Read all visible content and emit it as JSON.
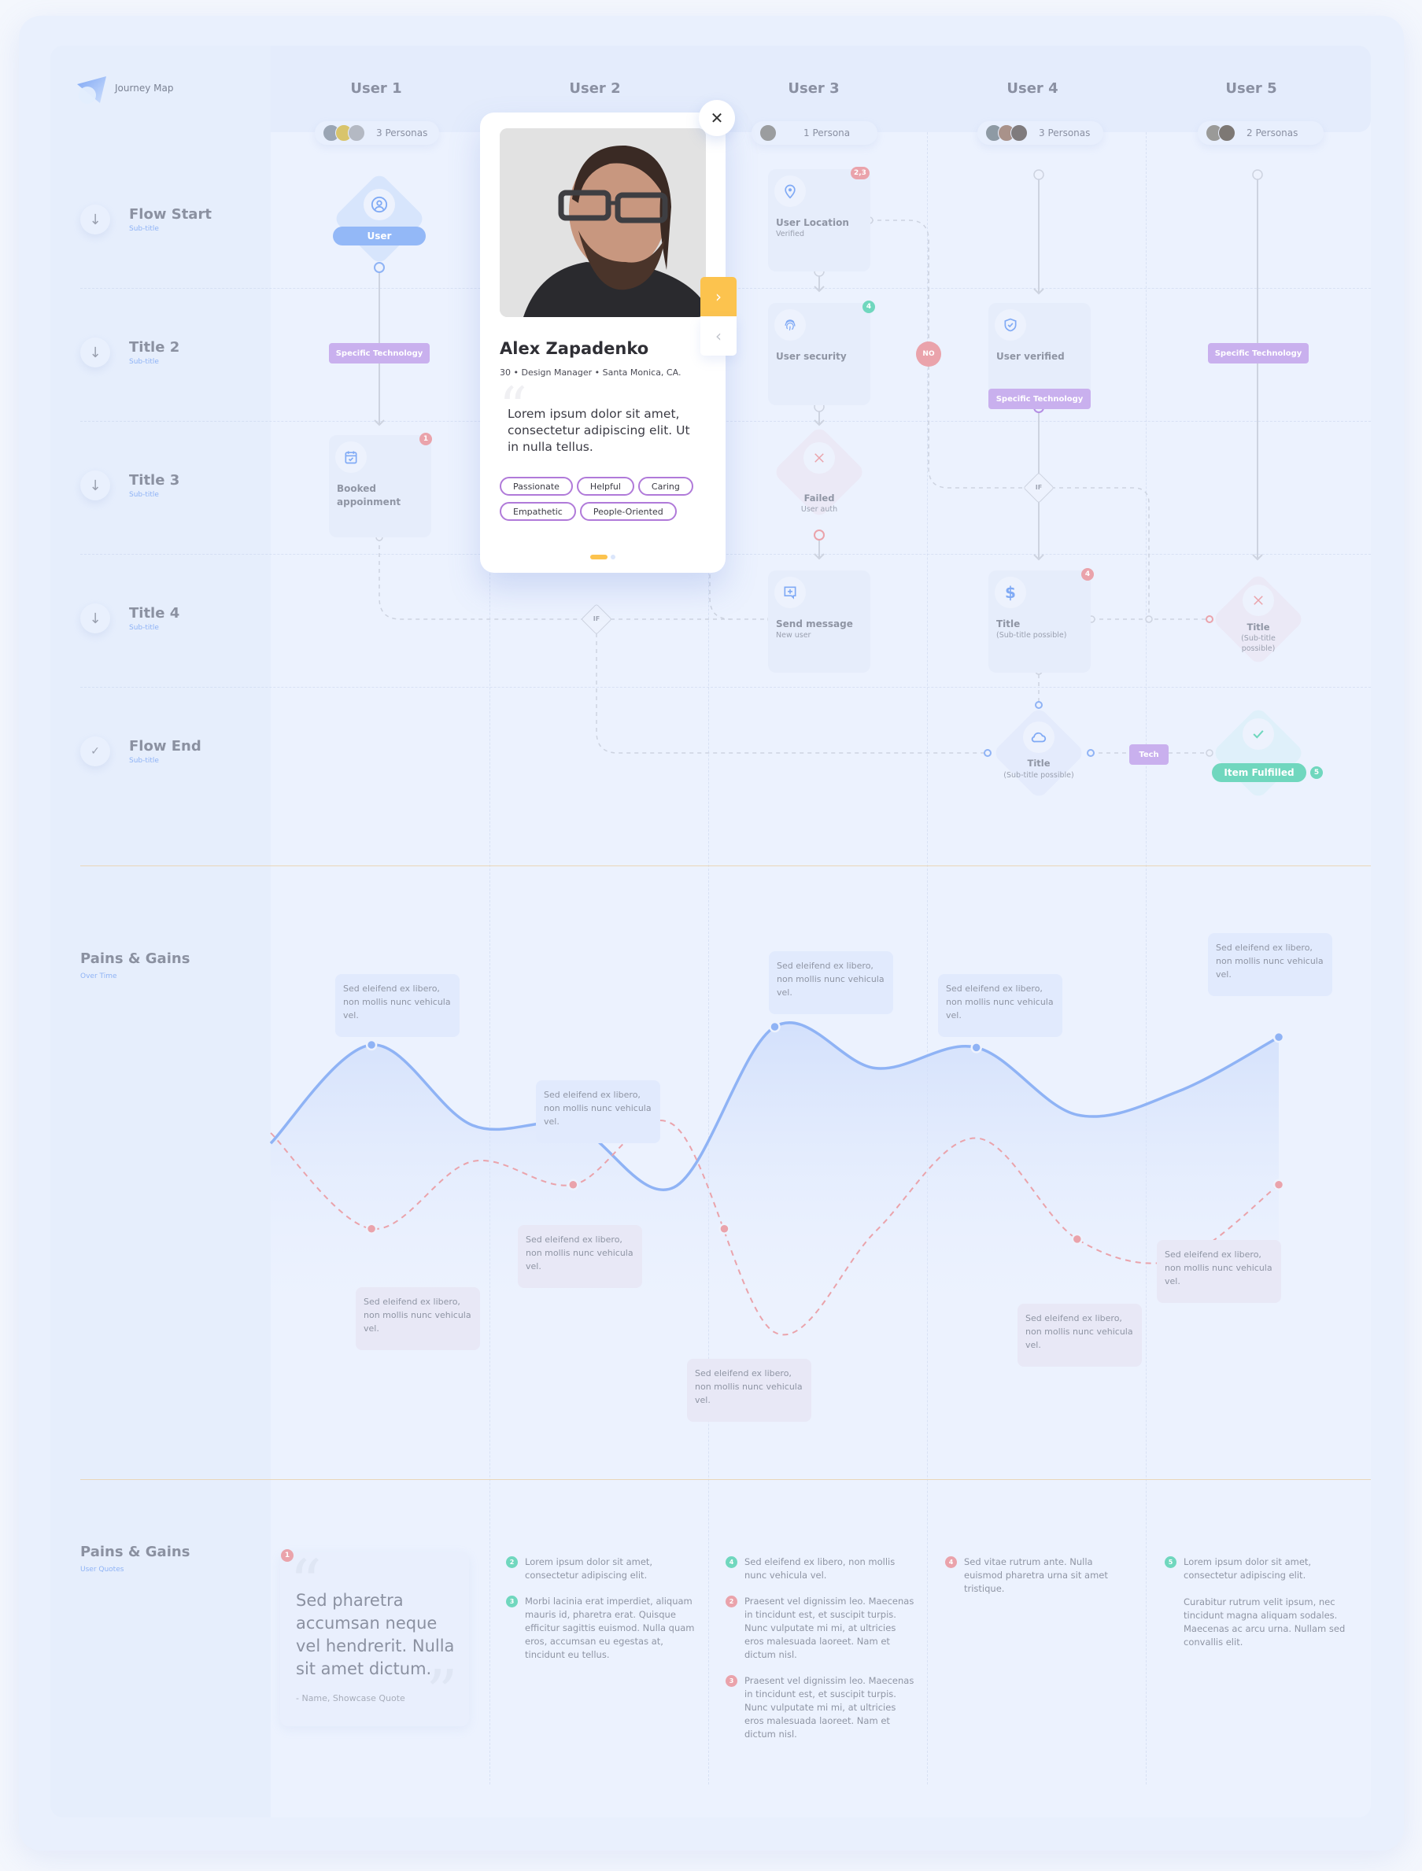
{
  "app": {
    "title": "Journey Map"
  },
  "colors": {
    "accent_blue": "#8fb3f5",
    "pain_red": "#eaa3ab",
    "gain_green": "#70d7be",
    "tech_purple": "#c9b0ee",
    "nav_yellow": "#fcc34e"
  },
  "users": [
    {
      "title": "User 1",
      "personas": "3 Personas",
      "avatar_count": 3
    },
    {
      "title": "User 2",
      "personas": "",
      "avatar_count": 0
    },
    {
      "title": "User 3",
      "personas": "1 Persona",
      "avatar_count": 1
    },
    {
      "title": "User 4",
      "personas": "3 Personas",
      "avatar_count": 3
    },
    {
      "title": "User 5",
      "personas": "2 Personas",
      "avatar_count": 2
    }
  ],
  "rows": [
    {
      "title": "Flow Start",
      "subtitle": "Sub-title",
      "icon": "arrow-down-icon"
    },
    {
      "title": "Title 2",
      "subtitle": "Sub-title",
      "icon": "arrow-down-icon"
    },
    {
      "title": "Title 3",
      "subtitle": "Sub-title",
      "icon": "arrow-down-icon"
    },
    {
      "title": "Title 4",
      "subtitle": "Sub-title",
      "icon": "arrow-down-icon"
    },
    {
      "title": "Flow End",
      "subtitle": "Sub-title",
      "icon": "check-icon"
    }
  ],
  "nodes": {
    "user_start": {
      "label": "User",
      "icon": "user-icon"
    },
    "tech_u1": "Specific Technology",
    "booked": {
      "title": "Booked appoinment",
      "badge": "1",
      "icon": "calendar-icon"
    },
    "user_location": {
      "title": "User Location",
      "subtitle": "Verified",
      "badge": "2,3",
      "icon": "location-pin-icon"
    },
    "user_security": {
      "title": "User security",
      "badge": "4",
      "icon": "fingerprint-icon"
    },
    "failed": {
      "title": "Failed",
      "subtitle": "User auth",
      "icon": "x-icon"
    },
    "send_message": {
      "title": "Send message",
      "subtitle": "New user",
      "icon": "message-plus-icon"
    },
    "no_label": "NO",
    "if_label": "IF",
    "user_verified": {
      "title": "User verified",
      "icon": "shield-check-icon"
    },
    "tech_u4": "Specific Technology",
    "title_dollar": {
      "title": "Title",
      "subtitle": "(Sub-title possible)",
      "badge": "4",
      "icon": "dollar-icon"
    },
    "title_cloud": {
      "title": "Title",
      "subtitle": "(Sub-title possible)",
      "icon": "cloud-icon"
    },
    "tech_small": "Tech",
    "tech_u5": "Specific Technology",
    "title_x": {
      "title": "Title",
      "subtitle": "(Sub-title possible)",
      "icon": "x-icon"
    },
    "item_fulfilled": {
      "label": "Item Fulfilled",
      "badge": "5",
      "icon": "check-icon"
    }
  },
  "persona_card": {
    "name": "Alex Zapadenko",
    "meta": "30 • Design Manager • Santa Monica, CA.",
    "quote": "Lorem ipsum dolor sit amet, consectetur adipiscing elit. Ut in nulla tellus.",
    "tags": [
      "Passionate",
      "Helpful",
      "Caring",
      "Empathetic",
      "People-Oriented"
    ],
    "page": 1,
    "page_count": 2,
    "close_icon": "close-icon",
    "next_icon": "chevron-right-icon",
    "prev_icon": "chevron-left-icon"
  },
  "pains_gains_chart": {
    "title": "Pains & Gains",
    "subtitle": "Over Time",
    "gain_tips": [
      "Sed eleifend ex libero, non mollis nunc vehicula vel.",
      "Sed eleifend ex libero, non mollis nunc vehicula vel.",
      "Sed eleifend ex libero, non mollis nunc vehicula vel.",
      "Sed eleifend ex libero, non mollis nunc vehicula vel.",
      "Sed eleifend ex libero, non mollis nunc vehicula vel."
    ],
    "pain_tips": [
      "Sed eleifend ex libero, non mollis nunc vehicula vel.",
      "Sed eleifend ex libero, non mollis nunc vehicula vel.",
      "Sed eleifend ex libero, non mollis nunc vehicula vel.",
      "Sed eleifend ex libero, non mollis nunc vehicula vel.",
      "Sed eleifend ex libero, non mollis nunc vehicula vel."
    ]
  },
  "chart_data": {
    "type": "line",
    "title": "Pains & Gains",
    "subtitle": "Over Time",
    "xlabel": "",
    "ylabel": "",
    "grid": false,
    "legend": "none",
    "series": [
      {
        "name": "Gains",
        "style": "solid",
        "color": "#8fb3f5",
        "x": [
          0,
          0.5,
          1.0,
          1.5,
          2.0,
          2.5,
          3.0,
          3.5,
          4.0,
          4.5,
          5.0
        ],
        "y": [
          0.55,
          0.93,
          0.62,
          0.62,
          0.38,
          1.0,
          0.84,
          0.92,
          0.66,
          0.75,
          0.96
        ],
        "markers_x": [
          0.5,
          1.5,
          2.5,
          3.5,
          5.0
        ]
      },
      {
        "name": "Pains",
        "style": "dashed",
        "color": "#eaa3ab",
        "x": [
          0,
          0.5,
          1.0,
          1.5,
          2.0,
          2.5,
          3.0,
          3.5,
          4.0,
          4.5,
          5.0
        ],
        "y": [
          0.59,
          0.22,
          0.48,
          0.39,
          0.62,
          -0.18,
          0.21,
          0.57,
          0.18,
          0.1,
          0.39
        ],
        "markers_x": [
          0.5,
          1.5,
          2.25,
          4.0,
          5.0
        ]
      }
    ]
  },
  "quotes": {
    "title": "Pains & Gains",
    "subtitle": "User Quotes",
    "showcase": {
      "badge": "1",
      "text": "Sed pharetra accumsan neque vel hendrerit. Nulla sit amet dictum.",
      "author": "- Name, Showcase Quote"
    },
    "columns": [
      [
        {
          "num": "2",
          "type": "gain",
          "paragraphs": [
            "Lorem ipsum dolor sit amet, consectetur adipiscing elit."
          ]
        },
        {
          "num": "3",
          "type": "gain",
          "paragraphs": [
            "Morbi lacinia erat imperdiet, aliquam mauris id, pharetra erat. Quisque efficitur sagittis euismod. Nulla quam eros, accumsan eu egestas at, tincidunt eu tellus."
          ]
        }
      ],
      [
        {
          "num": "4",
          "type": "gain",
          "paragraphs": [
            "Sed eleifend ex libero, non mollis nunc vehicula vel."
          ]
        },
        {
          "num": "2",
          "type": "pain",
          "paragraphs": [
            "Praesent vel dignissim leo. Maecenas in tincidunt est, et suscipit turpis. Nunc vulputate mi mi, at ultricies eros malesuada laoreet. Nam et dictum nisl."
          ]
        },
        {
          "num": "3",
          "type": "pain",
          "paragraphs": [
            "Praesent vel dignissim leo. Maecenas in tincidunt est, et suscipit turpis. Nunc vulputate mi mi, at ultricies eros malesuada laoreet. Nam et dictum nisl."
          ]
        }
      ],
      [
        {
          "num": "4",
          "type": "pain",
          "paragraphs": [
            "Sed vitae rutrum ante. Nulla euismod pharetra urna sit amet tristique."
          ]
        }
      ],
      [
        {
          "num": "5",
          "type": "gain",
          "paragraphs": [
            "Lorem ipsum dolor sit amet, consectetur adipiscing elit.",
            "Curabitur rutrum velit ipsum, nec tincidunt magna aliquam sodales. Maecenas ac arcu urna. Nullam sed convallis elit."
          ]
        }
      ]
    ]
  }
}
